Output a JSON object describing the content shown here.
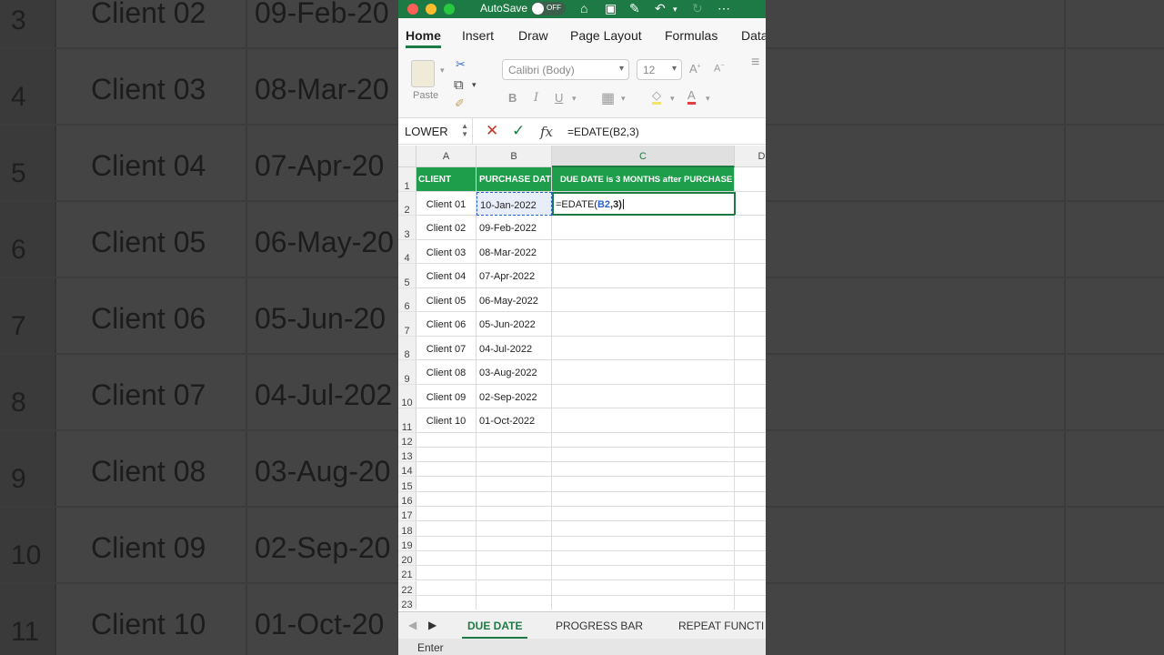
{
  "background": {
    "rows": [
      {
        "num": "3",
        "client": "Client 02",
        "date": "09-Feb-20"
      },
      {
        "num": "4",
        "client": "Client 03",
        "date": "08-Mar-20"
      },
      {
        "num": "5",
        "client": "Client 04",
        "date": "07-Apr-20"
      },
      {
        "num": "6",
        "client": "Client 05",
        "date": "06-May-20"
      },
      {
        "num": "7",
        "client": "Client 06",
        "date": "05-Jun-20"
      },
      {
        "num": "8",
        "client": "Client 07",
        "date": "04-Jul-202"
      },
      {
        "num": "9",
        "client": "Client 08",
        "date": "03-Aug-20"
      },
      {
        "num": "10",
        "client": "Client 09",
        "date": "02-Sep-20"
      },
      {
        "num": "11",
        "client": "Client 10",
        "date": "01-Oct-20"
      }
    ]
  },
  "titlebar": {
    "autosave_label": "AutoSave",
    "toggle_state": "OFF"
  },
  "ribbon_tabs": [
    "Home",
    "Insert",
    "Draw",
    "Page Layout",
    "Formulas",
    "Data"
  ],
  "ribbon": {
    "paste_label": "Paste",
    "font_name": "Calibri (Body)",
    "font_size": "12",
    "icons": [
      "paste-icon",
      "scissors-icon",
      "copy-icon",
      "format-painter-icon",
      "bold-icon",
      "italic-icon",
      "underline-icon",
      "borders-icon",
      "fill-color-icon",
      "font-color-icon"
    ]
  },
  "formula_bar": {
    "name_box": "LOWER",
    "fx": "fx",
    "content": "=EDATE(B2,3)"
  },
  "columns": [
    "A",
    "B",
    "C",
    "D"
  ],
  "header_row": {
    "a": "CLIENT",
    "b": "PURCHASE DATE",
    "c": "DUE DATE is 3 MONTHS after PURCHASE"
  },
  "data_rows": [
    {
      "client": "Client 01",
      "date": "10-Jan-2022"
    },
    {
      "client": "Client 02",
      "date": "09-Feb-2022"
    },
    {
      "client": "Client 03",
      "date": "08-Mar-2022"
    },
    {
      "client": "Client 04",
      "date": "07-Apr-2022"
    },
    {
      "client": "Client 05",
      "date": "06-May-2022"
    },
    {
      "client": "Client 06",
      "date": "05-Jun-2022"
    },
    {
      "client": "Client 07",
      "date": "04-Jul-2022"
    },
    {
      "client": "Client 08",
      "date": "03-Aug-2022"
    },
    {
      "client": "Client 09",
      "date": "02-Sep-2022"
    },
    {
      "client": "Client 10",
      "date": "01-Oct-2022"
    }
  ],
  "editing_cell": {
    "prefix": "=EDATE(",
    "ref": "B2",
    "suffix": ",3)"
  },
  "row_numbers": [
    "1",
    "2",
    "3",
    "4",
    "5",
    "6",
    "7",
    "8",
    "9",
    "10",
    "11",
    "12",
    "13",
    "14",
    "15",
    "16",
    "17",
    "18",
    "19",
    "20",
    "21",
    "22",
    "23"
  ],
  "sheet_tabs": [
    "DUE DATE",
    "PROGRESS BAR",
    "REPEAT FUNCTI"
  ],
  "status": "Enter",
  "colors": {
    "accent": "#1e7a44",
    "header_fill": "#1e9e4a",
    "ref_blue": "#2a62c9"
  }
}
